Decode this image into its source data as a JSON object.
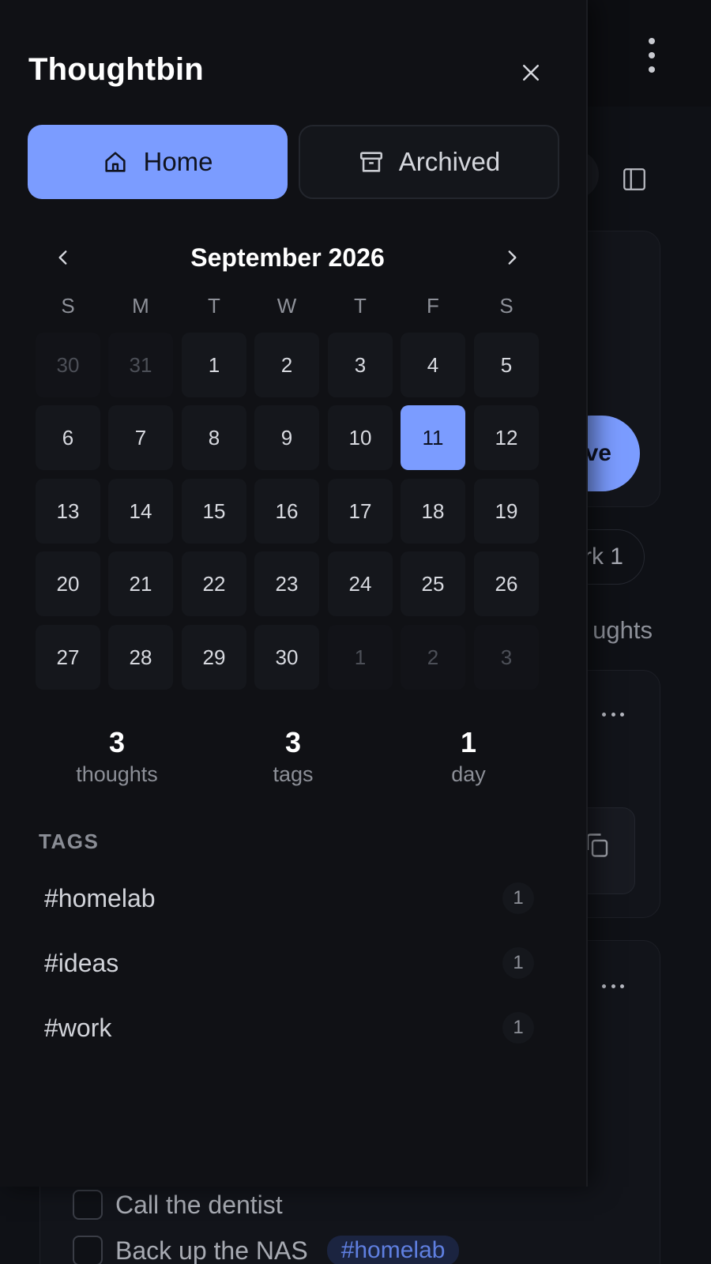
{
  "background": {
    "save_button_fragment": "ve",
    "chip_fragment": "rk 1",
    "section_fragment": "ughts",
    "tasks": [
      {
        "label": "Call the dentist",
        "tag": ""
      },
      {
        "label": "Back up the NAS",
        "tag": "#homelab"
      }
    ]
  },
  "drawer": {
    "title": "Thoughtbin",
    "nav": {
      "home_label": "Home",
      "archived_label": "Archived"
    },
    "calendar": {
      "month_label": "September 2026",
      "weekdays": [
        "S",
        "M",
        "T",
        "W",
        "T",
        "F",
        "S"
      ],
      "weeks": [
        [
          {
            "d": "30",
            "m": true
          },
          {
            "d": "31",
            "m": true
          },
          {
            "d": "1"
          },
          {
            "d": "2"
          },
          {
            "d": "3"
          },
          {
            "d": "4"
          },
          {
            "d": "5"
          }
        ],
        [
          {
            "d": "6"
          },
          {
            "d": "7"
          },
          {
            "d": "8"
          },
          {
            "d": "9"
          },
          {
            "d": "10"
          },
          {
            "d": "11",
            "s": true
          },
          {
            "d": "12"
          }
        ],
        [
          {
            "d": "13"
          },
          {
            "d": "14"
          },
          {
            "d": "15"
          },
          {
            "d": "16"
          },
          {
            "d": "17"
          },
          {
            "d": "18"
          },
          {
            "d": "19"
          }
        ],
        [
          {
            "d": "20"
          },
          {
            "d": "21"
          },
          {
            "d": "22"
          },
          {
            "d": "23"
          },
          {
            "d": "24"
          },
          {
            "d": "25"
          },
          {
            "d": "26"
          }
        ],
        [
          {
            "d": "27"
          },
          {
            "d": "28"
          },
          {
            "d": "29"
          },
          {
            "d": "30"
          },
          {
            "d": "1",
            "m": true
          },
          {
            "d": "2",
            "m": true
          },
          {
            "d": "3",
            "m": true
          }
        ]
      ]
    },
    "stats": [
      {
        "value": "3",
        "label": "thoughts"
      },
      {
        "value": "3",
        "label": "tags"
      },
      {
        "value": "1",
        "label": "day"
      }
    ],
    "tags_heading": "TAGS",
    "tags": [
      {
        "name": "#homelab",
        "count": "1"
      },
      {
        "name": "#ideas",
        "count": "1"
      },
      {
        "name": "#work",
        "count": "1"
      }
    ]
  },
  "colors": {
    "accent": "#7b9cff",
    "drawer_bg": "#101115",
    "page_bg": "#0b0c0f"
  }
}
